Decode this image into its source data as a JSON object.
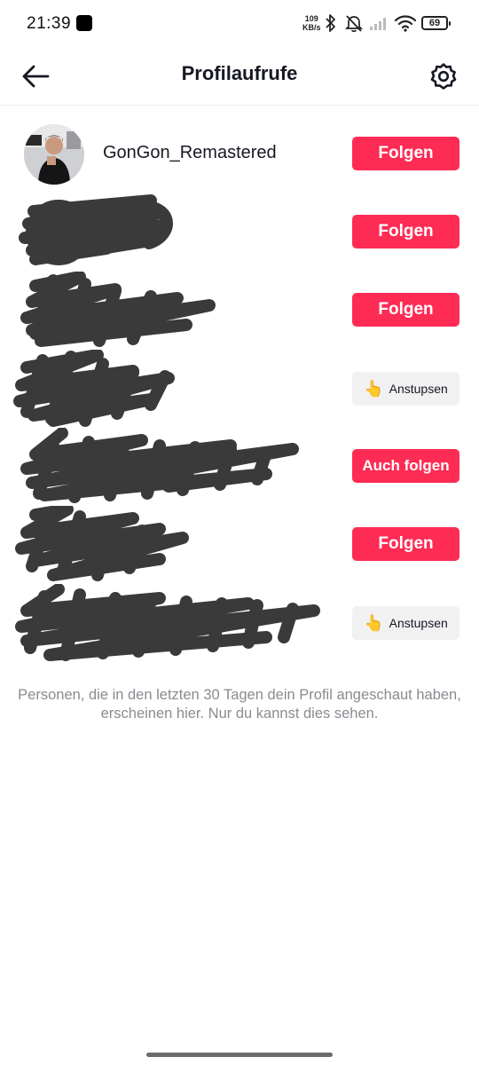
{
  "status_bar": {
    "time": "21:39",
    "net_speed_value": "109",
    "net_speed_unit": "KB/s",
    "battery": "69",
    "icons": [
      "app-notification-icon",
      "bluetooth-icon",
      "mute-icon",
      "signal-icon",
      "wifi-icon",
      "battery-icon"
    ]
  },
  "header": {
    "title": "Profilaufrufe",
    "back_icon": "arrow-left-icon",
    "settings_icon": "gear-icon"
  },
  "viewers": [
    {
      "username": "GonGon_Remastered",
      "redacted": false,
      "action": "Folgen",
      "action_type": "follow"
    },
    {
      "username": "",
      "redacted": true,
      "action": "Folgen",
      "action_type": "follow"
    },
    {
      "username": "",
      "redacted": true,
      "action": "Folgen",
      "action_type": "follow"
    },
    {
      "username": "",
      "redacted": true,
      "action": "Anstupsen",
      "action_type": "poke"
    },
    {
      "username": "",
      "redacted": true,
      "action": "Auch folgen",
      "action_type": "follow"
    },
    {
      "username": "",
      "redacted": true,
      "action": "Folgen",
      "action_type": "follow"
    },
    {
      "username": "",
      "redacted": true,
      "action": "Anstupsen",
      "action_type": "poke"
    }
  ],
  "footer_note": "Personen, die in den letzten 30 Tagen dein Profil angeschaut haben, erscheinen hier. Nur du kannst dies sehen.",
  "colors": {
    "accent": "#fe2c55",
    "poke_bg": "#f1f1f2",
    "note_text": "#8a8b91",
    "scribble": "#3a3a3a"
  }
}
